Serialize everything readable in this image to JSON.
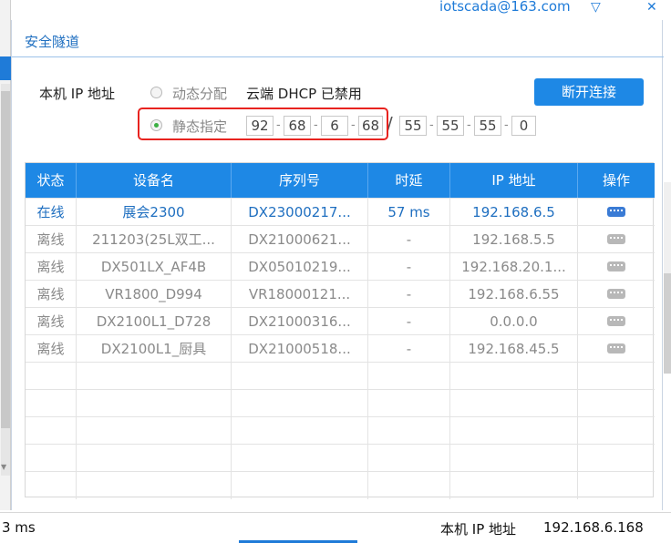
{
  "header": {
    "account": "iotscada@163.com",
    "dropdown_icon": "chevron-down-icon",
    "close_icon": "close-icon"
  },
  "dialog": {
    "title": "安全隧道",
    "local_ip_label": "本机 IP 地址",
    "option_dynamic": "动态分配",
    "dhcp_status": "云端 DHCP 已禁用",
    "option_static": "静态指定",
    "disconnect_label": "断开连接",
    "ip": [
      "92",
      "68",
      "6",
      "68"
    ],
    "mask": [
      "55",
      "55",
      "55",
      "0"
    ],
    "ip_separator": "-",
    "mask_separator": "/"
  },
  "table": {
    "columns": [
      "状态",
      "设备名",
      "序列号",
      "时延",
      "IP 地址",
      "操作"
    ],
    "rows": [
      {
        "status": "在线",
        "name": "展会2300",
        "serial": "DX23000217...",
        "latency": "57 ms",
        "ip": "192.168.6.5",
        "online": true
      },
      {
        "status": "离线",
        "name": "211203(25L双工...",
        "serial": "DX21000621...",
        "latency": "-",
        "ip": "192.168.5.5",
        "online": false
      },
      {
        "status": "离线",
        "name": "DX501LX_AF4B",
        "serial": "DX05010219...",
        "latency": "-",
        "ip": "192.168.20.1...",
        "online": false
      },
      {
        "status": "离线",
        "name": "VR1800_D994",
        "serial": "VR18000121...",
        "latency": "-",
        "ip": "192.168.6.55",
        "online": false
      },
      {
        "status": "离线",
        "name": "DX2100L1_D728",
        "serial": "DX21000316...",
        "latency": "-",
        "ip": "0.0.0.0",
        "online": false
      },
      {
        "status": "离线",
        "name": "DX2100L1_厨具",
        "serial": "DX21000518...",
        "latency": "-",
        "ip": "192.168.45.5",
        "online": false
      }
    ]
  },
  "statusbar": {
    "latency": "3 ms",
    "local_ip_label": "本机 IP 地址",
    "local_ip": "192.168.6.168"
  },
  "colors": {
    "accent": "#1e88e5",
    "online": "#1f6fc0",
    "offline": "#8a8a8a",
    "highlight": "#e8231f"
  }
}
